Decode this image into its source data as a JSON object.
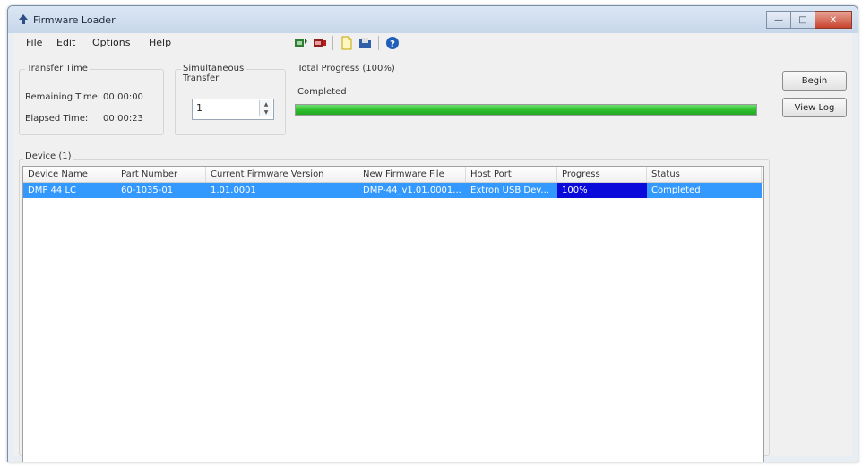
{
  "window": {
    "title": "Firmware Loader"
  },
  "menu": [
    {
      "label": "File"
    },
    {
      "label": "Edit"
    },
    {
      "label": "Options"
    },
    {
      "label": "Help"
    }
  ],
  "toolbar": {
    "icons": [
      "connect-device-icon",
      "disconnect-device-icon",
      "new-file-icon",
      "open-folder-icon",
      "help-icon"
    ]
  },
  "transfer_time": {
    "title": "Transfer Time",
    "remaining_label": "Remaining Time:",
    "remaining_value": "00:00:00",
    "elapsed_label": "Elapsed Time:",
    "elapsed_value": "00:00:23"
  },
  "simultaneous": {
    "title_line1": "Simultaneous",
    "title_line2": "Transfer",
    "value": "1"
  },
  "total_progress": {
    "title": "Total Progress (100%)",
    "status": "Completed",
    "percent": 100
  },
  "buttons": {
    "begin": "Begin",
    "view_log": "View Log"
  },
  "devices": {
    "title": "Device (1)",
    "columns": [
      "Device Name",
      "Part Number",
      "Current Firmware Version",
      "New Firmware File",
      "Host Port",
      "Progress",
      "Status"
    ],
    "rows": [
      {
        "device_name": "DMP 44 LC",
        "part_number": "60-1035-01",
        "current_version": "1.01.0001",
        "new_file": "DMP-44_v1.01.0001...",
        "host_port": "Extron USB Dev...",
        "progress": "100%",
        "status": "Completed"
      }
    ]
  },
  "colors": {
    "selection": "#3399ff",
    "progress_cell": "#0a0adb",
    "progress_fill": "#2fbf2f"
  }
}
